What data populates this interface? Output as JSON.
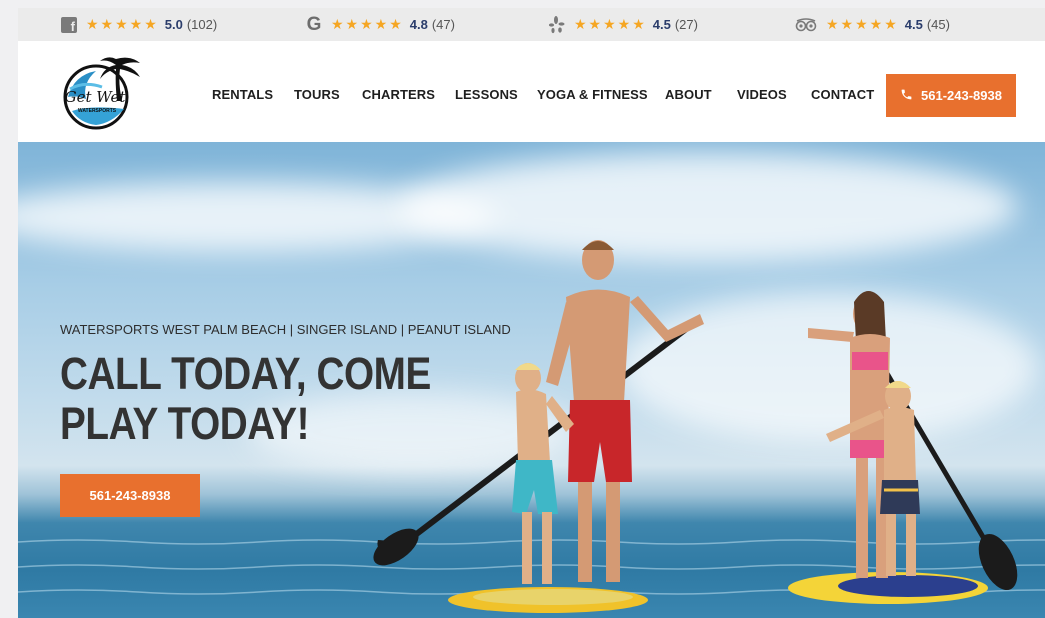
{
  "reviews": [
    {
      "icon": "facebook-icon",
      "stars": "★★★★★",
      "score": "5.0",
      "count": "(102)"
    },
    {
      "icon": "google-icon",
      "stars": "★★★★★",
      "score": "4.8",
      "count": "(47)"
    },
    {
      "icon": "yelp-icon",
      "stars": "★★★★★",
      "score": "4.5",
      "count": "(27)"
    },
    {
      "icon": "tripadvisor-icon",
      "stars": "★★★★★",
      "score": "4.5",
      "count": "(45)"
    }
  ],
  "logo": {
    "name": "Get Wet",
    "tagline": "WATERSPORTS"
  },
  "nav": {
    "items": [
      "RENTALS",
      "TOURS",
      "CHARTERS",
      "LESSONS",
      "YOGA & FITNESS",
      "ABOUT",
      "VIDEOS",
      "CONTACT"
    ],
    "phone": "561-243-8938"
  },
  "hero": {
    "subtitle": "WATERSPORTS WEST PALM BEACH | SINGER ISLAND | PEANUT ISLAND",
    "title": "CALL TODAY, COME PLAY TODAY!",
    "button": "561-243-8938"
  },
  "colors": {
    "accent": "#e8702e",
    "score": "#2b3d6b",
    "star": "#f5a623"
  }
}
